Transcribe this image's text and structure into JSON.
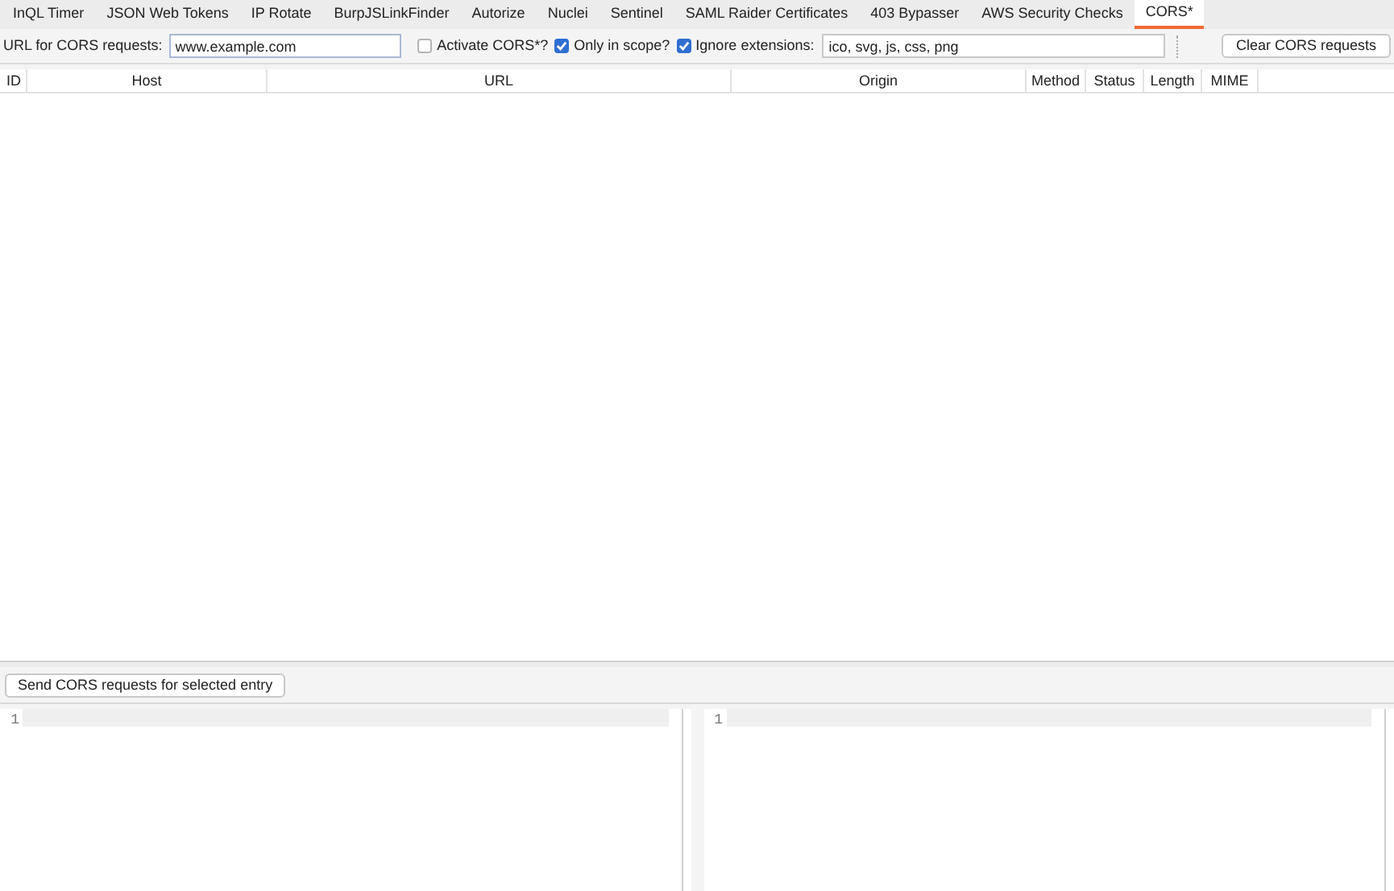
{
  "tabs": [
    {
      "label": "InQL Timer",
      "selected": false
    },
    {
      "label": "JSON Web Tokens",
      "selected": false
    },
    {
      "label": "IP Rotate",
      "selected": false
    },
    {
      "label": "BurpJSLinkFinder",
      "selected": false
    },
    {
      "label": "Autorize",
      "selected": false
    },
    {
      "label": "Nuclei",
      "selected": false
    },
    {
      "label": "Sentinel",
      "selected": false
    },
    {
      "label": "SAML Raider Certificates",
      "selected": false
    },
    {
      "label": "403 Bypasser",
      "selected": false
    },
    {
      "label": "AWS Security Checks",
      "selected": false
    },
    {
      "label": "CORS*",
      "selected": true
    }
  ],
  "toolbar": {
    "url_label": "URL for CORS requests:",
    "url_value": "www.example.com",
    "options": [
      {
        "label": "Activate CORS*?",
        "checked": false
      },
      {
        "label": "Only in scope?",
        "checked": true
      },
      {
        "label": "Ignore extensions:",
        "checked": true
      }
    ],
    "extensions_value": "ico, svg, js, css, png",
    "clear_button": "Clear CORS requests"
  },
  "table": {
    "columns": [
      "ID",
      "Host",
      "URL",
      "Origin",
      "Method",
      "Status",
      "Length",
      "MIME"
    ]
  },
  "send_button": "Send CORS requests for selected entry",
  "editors": [
    {
      "line_number": "1"
    },
    {
      "line_number": "1"
    }
  ]
}
